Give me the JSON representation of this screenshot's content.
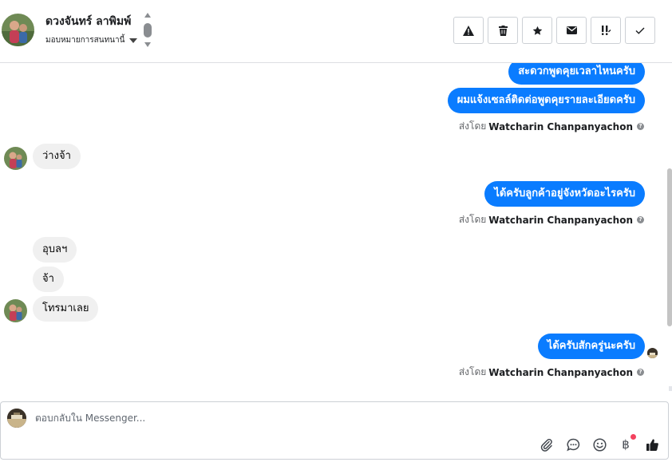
{
  "header": {
    "contact_name": "ดวงจันทร์ ลาพิมพ์",
    "assign_label": "มอบหมายการสนทนานี้",
    "actions": [
      {
        "icon": "warning-icon",
        "name": "mark-spam-button"
      },
      {
        "icon": "trash-icon",
        "name": "delete-button"
      },
      {
        "icon": "star-icon",
        "name": "star-button"
      },
      {
        "icon": "envelope-icon",
        "name": "mark-unread-button"
      },
      {
        "icon": "follow-up-icon",
        "name": "follow-up-button"
      },
      {
        "icon": "check-icon",
        "name": "mark-done-button"
      }
    ]
  },
  "thread": {
    "messages": [
      {
        "direction": "out",
        "text": "สะดวกพูดคุยเวลาไหนครับ"
      },
      {
        "direction": "out",
        "text": "ผมแจ้งเซลล์ติดต่อพูดคุยรายละเอียดครับ"
      },
      {
        "direction": "meta",
        "prefix": "ส่งโดย",
        "sender": "Watcharin Chanpanyachon"
      },
      {
        "direction": "in",
        "text": "ว่างจ้า"
      },
      {
        "direction": "out",
        "text": "ได้ครับลูกค้าอยู่จังหวัดอะไรครับ"
      },
      {
        "direction": "meta",
        "prefix": "ส่งโดย",
        "sender": "Watcharin Chanpanyachon"
      },
      {
        "direction": "in",
        "text": "อุบลฯ"
      },
      {
        "direction": "in",
        "text": "จ้า"
      },
      {
        "direction": "in",
        "text": "โทรมาเลย"
      },
      {
        "direction": "out",
        "text": "ได้ครับสักครู่นะครับ"
      },
      {
        "direction": "meta",
        "prefix": "ส่งโดย",
        "sender": "Watcharin Chanpanyachon"
      }
    ]
  },
  "composer": {
    "placeholder": "ตอบกลับใน Messenger...",
    "value": "",
    "tools": [
      "attachment-icon",
      "saved-reply-icon",
      "emoji-icon",
      "baht-payment-icon",
      "thumbs-up-icon"
    ],
    "baht_symbol": "฿"
  },
  "colors": {
    "outgoing_bubble": "#0a7cff",
    "incoming_bubble": "#f0f0f0",
    "notification_dot": "#f3425f"
  }
}
